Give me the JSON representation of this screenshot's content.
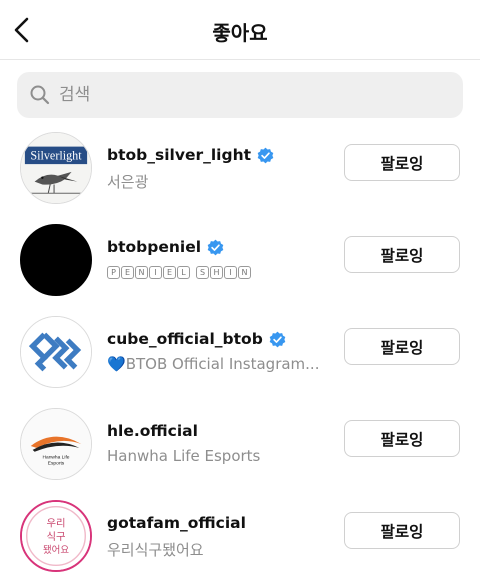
{
  "header": {
    "title": "좋아요",
    "back_icon": "chevron-left-icon"
  },
  "search": {
    "placeholder": "검색",
    "icon": "search-icon"
  },
  "colors": {
    "verified_badge": "#3897f0",
    "secondary_text": "#8e8e8e",
    "search_bg": "#efefef",
    "button_border": "#d0d0d0"
  },
  "users": [
    {
      "username": "btob_silver_light",
      "verified": true,
      "subtitle": "서은광",
      "button_label": "팔로잉",
      "avatar_text": "Silverlight"
    },
    {
      "username": "btobpeniel",
      "verified": true,
      "subtitle": "PENIEL SHIN",
      "button_label": "팔로잉"
    },
    {
      "username": "cube_official_btob",
      "verified": true,
      "subtitle_emoji": "💙",
      "subtitle": "BTOB Official Instagram...",
      "button_label": "팔로잉"
    },
    {
      "username": "hle.official",
      "verified": false,
      "subtitle": "Hanwha Life Esports",
      "button_label": "팔로잉",
      "avatar_text": "Hanwha Life Esports"
    },
    {
      "username": "gotafam_official",
      "verified": false,
      "subtitle": "우리식구됐어요",
      "button_label": "팔로잉",
      "avatar_text": "우리 식구 됐어요"
    }
  ]
}
